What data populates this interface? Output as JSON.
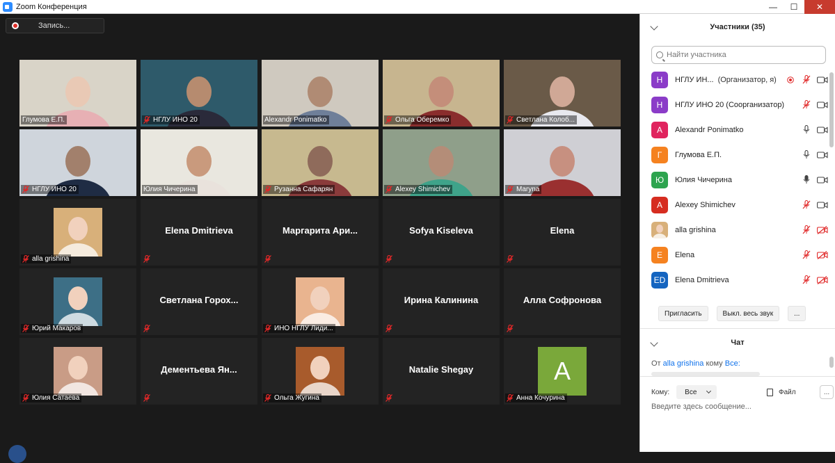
{
  "window": {
    "title": "Zoom Конференция"
  },
  "recording": {
    "label": "Запись..."
  },
  "tiles": [
    {
      "name": "Глумова Е.П.",
      "kind": "video",
      "muted": false,
      "bg": "#d9d4c8",
      "person": "#e9c9b5",
      "shirt": "#e7b0b4",
      "active": false
    },
    {
      "name": "НГЛУ ИНО 20",
      "kind": "video",
      "muted": true,
      "bg": "#2e5a6a",
      "person": "#b68b6f",
      "shirt": "#2a2a3a",
      "active": false
    },
    {
      "name": "Alexandr Ponimatko",
      "kind": "video",
      "muted": false,
      "bg": "#cfc9bf",
      "person": "#b08b74",
      "shirt": "#6f7f99",
      "active": false
    },
    {
      "name": "Ольга Оберемко",
      "kind": "video",
      "muted": true,
      "bg": "#c7b58f",
      "person": "#c48e7a",
      "shirt": "#8a2d2d",
      "active": false
    },
    {
      "name": "Светлана Колоб...",
      "kind": "video",
      "muted": true,
      "bg": "#6a5a48",
      "person": "#d0a896",
      "shirt": "#e8e8ee",
      "active": false
    },
    {
      "name": "НГЛУ ИНО 20",
      "kind": "video",
      "muted": true,
      "bg": "#cfd5dc",
      "person": "#a2806c",
      "shirt": "#1f2c44",
      "active": false
    },
    {
      "name": "Юлия Чичерина",
      "kind": "video",
      "muted": false,
      "bg": "#e9e7df",
      "person": "#c99a7d",
      "shirt": "#e9e2dc",
      "active": true
    },
    {
      "name": "Рузанна Сафарян",
      "kind": "video",
      "muted": true,
      "bg": "#c7b98f",
      "person": "#8f6b5b",
      "shirt": "#8a3b3b",
      "active": false
    },
    {
      "name": "Alexey Shimichev",
      "kind": "video",
      "muted": true,
      "bg": "#8f9f8a",
      "person": "#b48d78",
      "shirt": "#3fa38a",
      "active": false
    },
    {
      "name": "Maryna",
      "kind": "video",
      "muted": true,
      "bg": "#cfcfd4",
      "person": "#c79080",
      "shirt": "#9a3030",
      "active": false
    },
    {
      "name": "alla grishina",
      "kind": "avatar",
      "muted": true,
      "avatar_color": "#d8b07a",
      "active": false
    },
    {
      "name": "Elena Dmitrieva",
      "kind": "name",
      "muted": true,
      "active": false
    },
    {
      "name": "Маргарита  Ари...",
      "kind": "name",
      "muted": true,
      "active": false
    },
    {
      "name": "Sofya Kiseleva",
      "kind": "name",
      "muted": true,
      "active": false
    },
    {
      "name": "Elena",
      "kind": "name",
      "muted": true,
      "active": false
    },
    {
      "name": "Юрий Макаров",
      "kind": "avatar",
      "muted": true,
      "avatar_color": "#3d6f86",
      "active": false
    },
    {
      "name": "Светлана  Горох...",
      "kind": "name",
      "muted": true,
      "active": false
    },
    {
      "name": "ИНО НГЛУ Лиди...",
      "kind": "avatar",
      "muted": true,
      "avatar_color": "#e9b48f",
      "active": false
    },
    {
      "name": "Ирина Калинина",
      "kind": "name",
      "muted": true,
      "active": false
    },
    {
      "name": "Алла Софронова",
      "kind": "name",
      "muted": true,
      "active": false
    },
    {
      "name": "Юлия Сатаева",
      "kind": "avatar",
      "muted": true,
      "avatar_color": "#c99c86",
      "active": false
    },
    {
      "name": "Дементьева  Ян...",
      "kind": "name",
      "muted": true,
      "active": false
    },
    {
      "name": "Ольга Жугина",
      "kind": "avatar",
      "muted": true,
      "avatar_color": "#a85b2c",
      "active": false
    },
    {
      "name": "Natalie Shegay",
      "kind": "name",
      "muted": true,
      "active": false
    },
    {
      "name": "Анна Кочурина",
      "kind": "letter",
      "muted": true,
      "letter": "A",
      "avatar_color": "#7aa83a",
      "active": false
    }
  ],
  "participants_panel": {
    "title": "Участники (35)",
    "search_placeholder": "Найти участника",
    "participants": [
      {
        "initial": "Н",
        "color": "#8b3cc8",
        "name": "НГЛУ ИН...",
        "note": "(Организатор, я)",
        "recording": true,
        "mic": "muted",
        "video": "on"
      },
      {
        "initial": "Н",
        "color": "#8b3cc8",
        "name": "НГЛУ ИНО 20 (Соорганизатор)",
        "note": "",
        "recording": false,
        "mic": "muted",
        "video": "on"
      },
      {
        "initial": "A",
        "color": "#e0245e",
        "name": "Alexandr Ponimatko",
        "note": "",
        "recording": false,
        "mic": "on",
        "video": "on"
      },
      {
        "initial": "Г",
        "color": "#f58220",
        "name": "Глумова Е.П.",
        "note": "",
        "recording": false,
        "mic": "on",
        "video": "on"
      },
      {
        "initial": "Ю",
        "color": "#2ea44f",
        "name": "Юлия Чичерина",
        "note": "",
        "recording": false,
        "mic": "active",
        "video": "on"
      },
      {
        "initial": "A",
        "color": "#d62d20",
        "name": "Alexey Shimichev",
        "note": "",
        "recording": false,
        "mic": "muted",
        "video": "on"
      },
      {
        "initial": "",
        "color": "#d8b07a",
        "name": "alla grishina",
        "note": "",
        "recording": false,
        "mic": "muted",
        "video": "off"
      },
      {
        "initial": "E",
        "color": "#f58220",
        "name": "Elena",
        "note": "",
        "recording": false,
        "mic": "muted",
        "video": "off"
      },
      {
        "initial": "ED",
        "color": "#1565c0",
        "name": "Elena Dmitrieva",
        "note": "",
        "recording": false,
        "mic": "muted",
        "video": "off"
      }
    ],
    "invite_label": "Пригласить",
    "mute_all_label": "Выкл. весь звук",
    "more_label": "..."
  },
  "chat_panel": {
    "title": "Чат",
    "msg_from_prefix": "От",
    "msg_from_name": "alla grishina",
    "msg_to_text": "кому",
    "msg_to_name": "Все:",
    "to_label": "Кому:",
    "to_value": "Все",
    "file_label": "Файл",
    "more_label": "...",
    "input_placeholder": "Введите здесь сообщение..."
  },
  "colors": {
    "active_speaker": "#e5e26c",
    "muted_red": "#e02828",
    "link_blue": "#0e71eb"
  }
}
